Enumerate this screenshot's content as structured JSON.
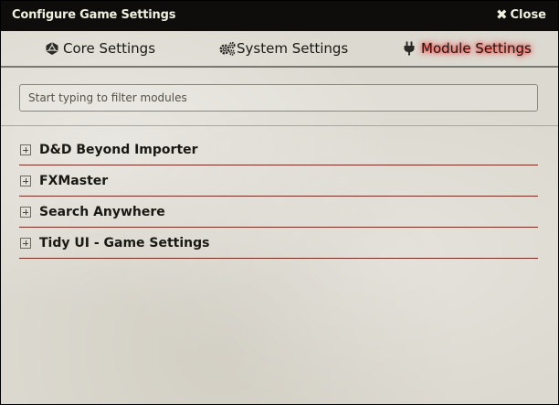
{
  "window": {
    "title": "Configure Game Settings",
    "close_label": "Close"
  },
  "tabs": [
    {
      "label": "Core Settings",
      "icon": "d20-icon",
      "active": false
    },
    {
      "label": "System Settings",
      "icon": "gears-icon",
      "active": false
    },
    {
      "label": "Module Settings",
      "icon": "plug-icon",
      "active": true
    }
  ],
  "filter": {
    "placeholder": "Start typing to filter modules",
    "value": ""
  },
  "modules": [
    {
      "name": "D&D Beyond Importer"
    },
    {
      "name": "FXMaster"
    },
    {
      "name": "Search Anywhere"
    },
    {
      "name": "Tidy UI - Game Settings"
    }
  ],
  "colors": {
    "titlebar_bg": "#0e0d0b",
    "panel_bg": "#dcd9d0",
    "row_divider": "#782e22",
    "active_glow": "#ff0000"
  }
}
